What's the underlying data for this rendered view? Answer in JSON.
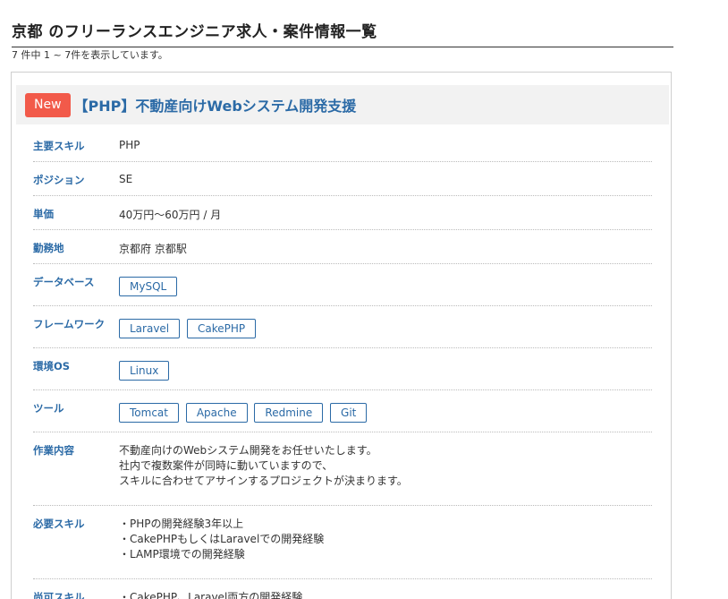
{
  "page": {
    "title": "京都 のフリーランスエンジニア求人・案件情報一覧",
    "result_count": "7 件中 1 ~ 7件を表示しています。"
  },
  "job": {
    "badge": "New",
    "title": "【PHP】不動産向けWebシステム開発支援",
    "main_skill": {
      "label": "主要スキル",
      "value": "PHP"
    },
    "position": {
      "label": "ポジション",
      "value": "SE"
    },
    "price": {
      "label": "単価",
      "value": "40万円〜60万円 / 月"
    },
    "location": {
      "label": "勤務地",
      "value": "京都府 京都駅"
    },
    "database": {
      "label": "データベース",
      "tags": [
        "MySQL"
      ]
    },
    "framework": {
      "label": "フレームワーク",
      "tags": [
        "Laravel",
        "CakePHP"
      ]
    },
    "os": {
      "label": "環境OS",
      "tags": [
        "Linux"
      ]
    },
    "tools": {
      "label": "ツール",
      "tags": [
        "Tomcat",
        "Apache",
        "Redmine",
        "Git"
      ]
    },
    "work": {
      "label": "作業内容",
      "lines": [
        "不動産向けのWebシステム開発をお任せいたします。",
        "社内で複数案件が同時に動いていますので、",
        "スキルに合わせてアサインするプロジェクトが決まります。"
      ]
    },
    "required": {
      "label": "必要スキル",
      "lines": [
        "・PHPの開発経験3年以上",
        "・CakePHPもしくはLaravelでの開発経験",
        "・LAMP環境での開発経験"
      ]
    },
    "optional": {
      "label": "尚可スキル",
      "lines": [
        "・CakePHP、Laravel両方の開発経験"
      ]
    }
  }
}
